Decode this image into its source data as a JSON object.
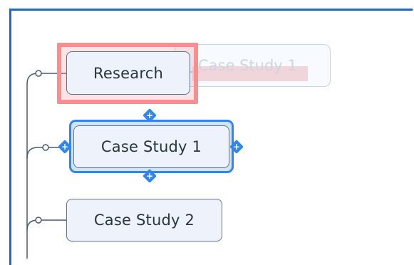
{
  "topics": {
    "research": "Research",
    "case_study_1": "Case Study 1",
    "case_study_2": "Case Study 2",
    "drag_preview": "Case Study 1"
  },
  "handles": {
    "top": "+",
    "bottom": "+",
    "left": "+",
    "right": "+"
  },
  "colors": {
    "frame_border": "#1b6ac9",
    "selection": "#2f86f0",
    "drop_target": "#f58f92",
    "node_fill": "#eef2fa",
    "node_border": "#5e7492",
    "connector": "#4a5a70"
  }
}
